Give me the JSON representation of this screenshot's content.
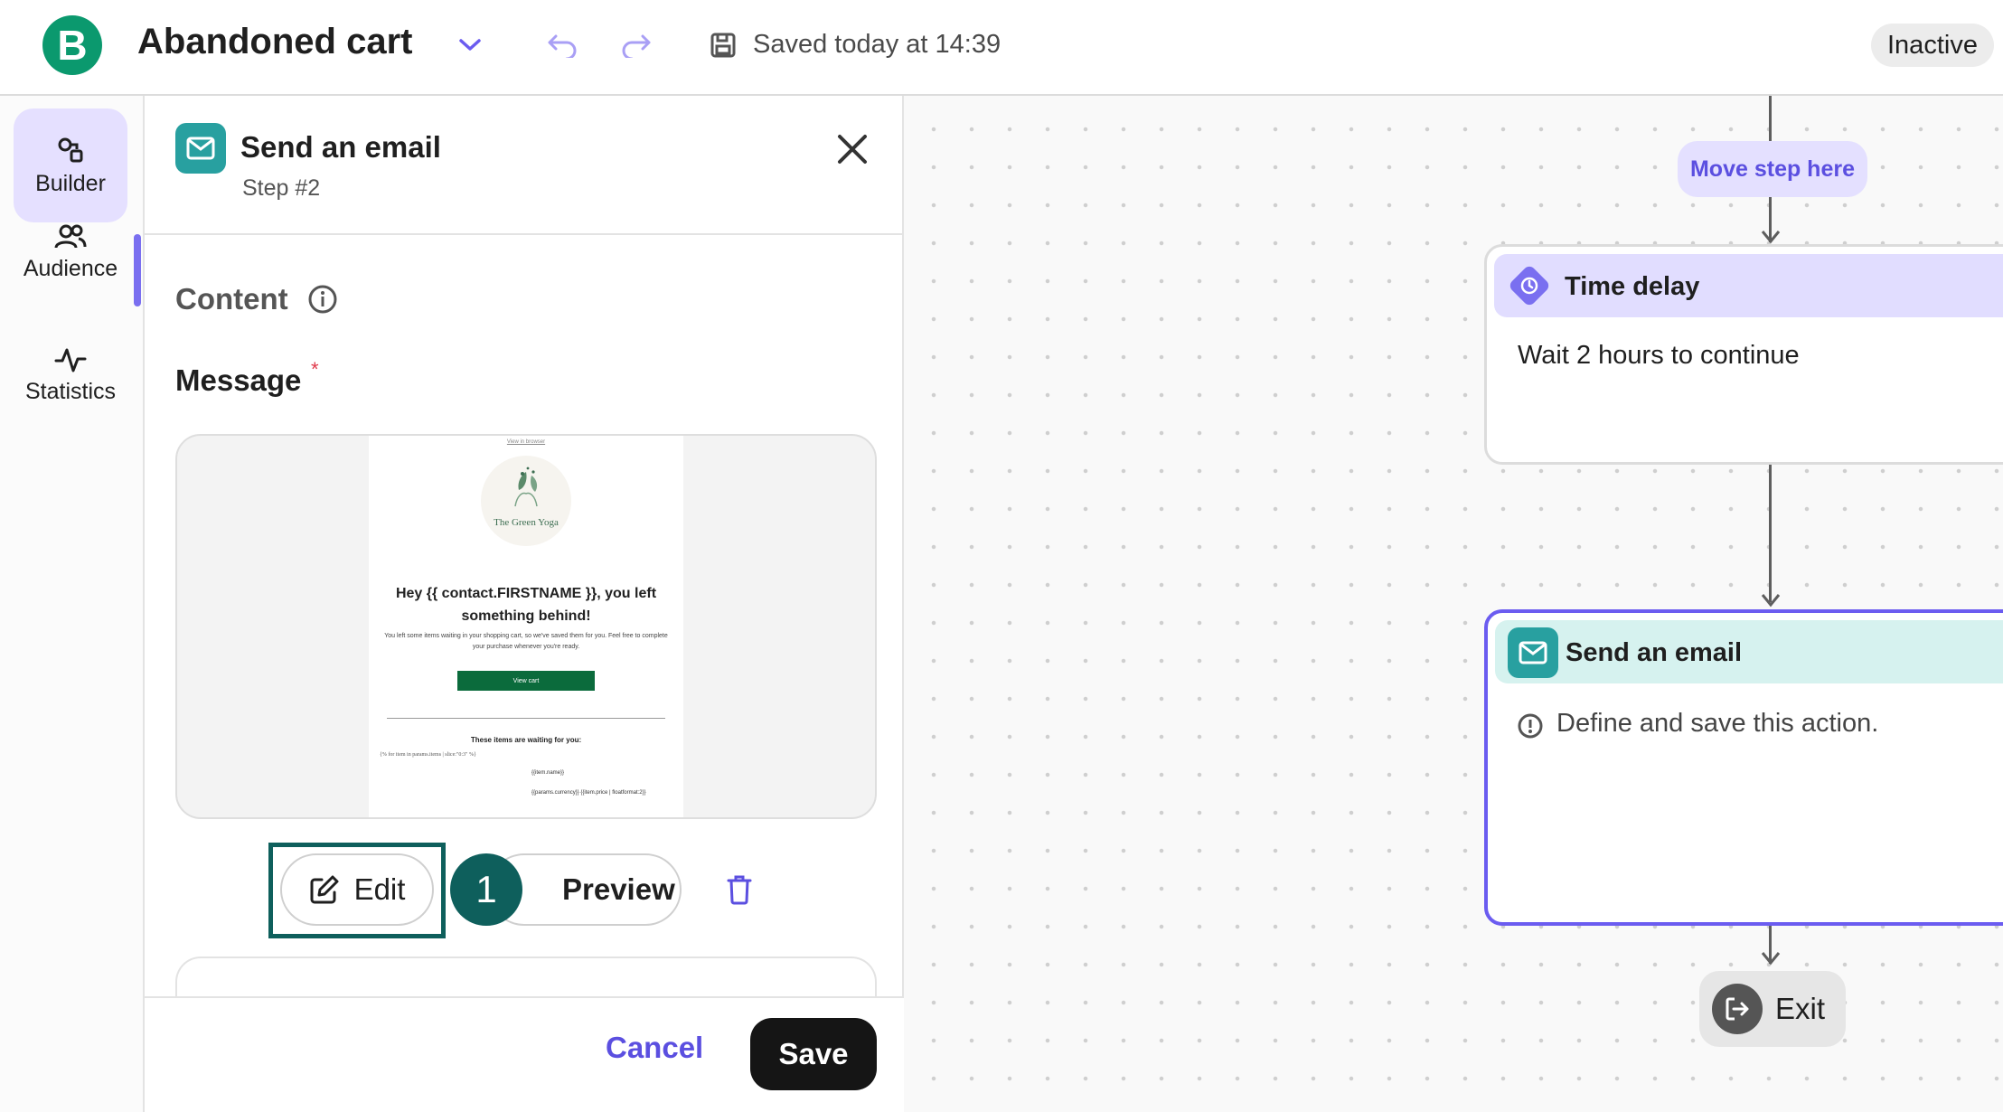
{
  "header": {
    "logo_letter": "B",
    "workflow_title": "Abandoned cart",
    "saved_status": "Saved today at 14:39",
    "status_badge": "Inactive"
  },
  "sidebar": {
    "items": [
      {
        "label": "Builder",
        "icon": "builder-icon",
        "active": true
      },
      {
        "label": "Audience",
        "icon": "audience-icon",
        "active": false
      },
      {
        "label": "Statistics",
        "icon": "statistics-icon",
        "active": false
      }
    ]
  },
  "panel": {
    "title": "Send an email",
    "step": "Step #2",
    "content_label": "Content",
    "message_label": "Message",
    "required_mark": "*",
    "email_preview": {
      "view_in_browser": "View in browser",
      "brand_name": "The Green Yoga",
      "headline": "Hey {{ contact.FIRSTNAME }}, you left something behind!",
      "body": "You left some items waiting in your shopping cart, so we've saved them for you. Feel free to complete your purchase whenever you're ready.",
      "cta": "View cart",
      "items_title": "These items are waiting for you:",
      "loop_tag": "{% for item in params.items | slice:\"0:3\" %}",
      "item_name": "{{item.name}}",
      "item_price": "{{params.currency}} {{item.price | floatformat:2}}"
    },
    "edit_label": "Edit",
    "preview_label": "Preview",
    "step_badge": "1",
    "cancel_label": "Cancel",
    "save_label": "Save"
  },
  "canvas": {
    "move_step_label": "Move step here",
    "time_delay": {
      "title": "Time delay",
      "description": "Wait 2 hours to continue"
    },
    "send_email": {
      "title": "Send an email",
      "warning": "Define and save this action."
    },
    "exit_label": "Exit"
  },
  "colors": {
    "brand_green": "#0b996e",
    "accent_purple": "#6b5cf0",
    "teal": "#28a0a0",
    "highlight_dark_teal": "#0e5f5c"
  }
}
